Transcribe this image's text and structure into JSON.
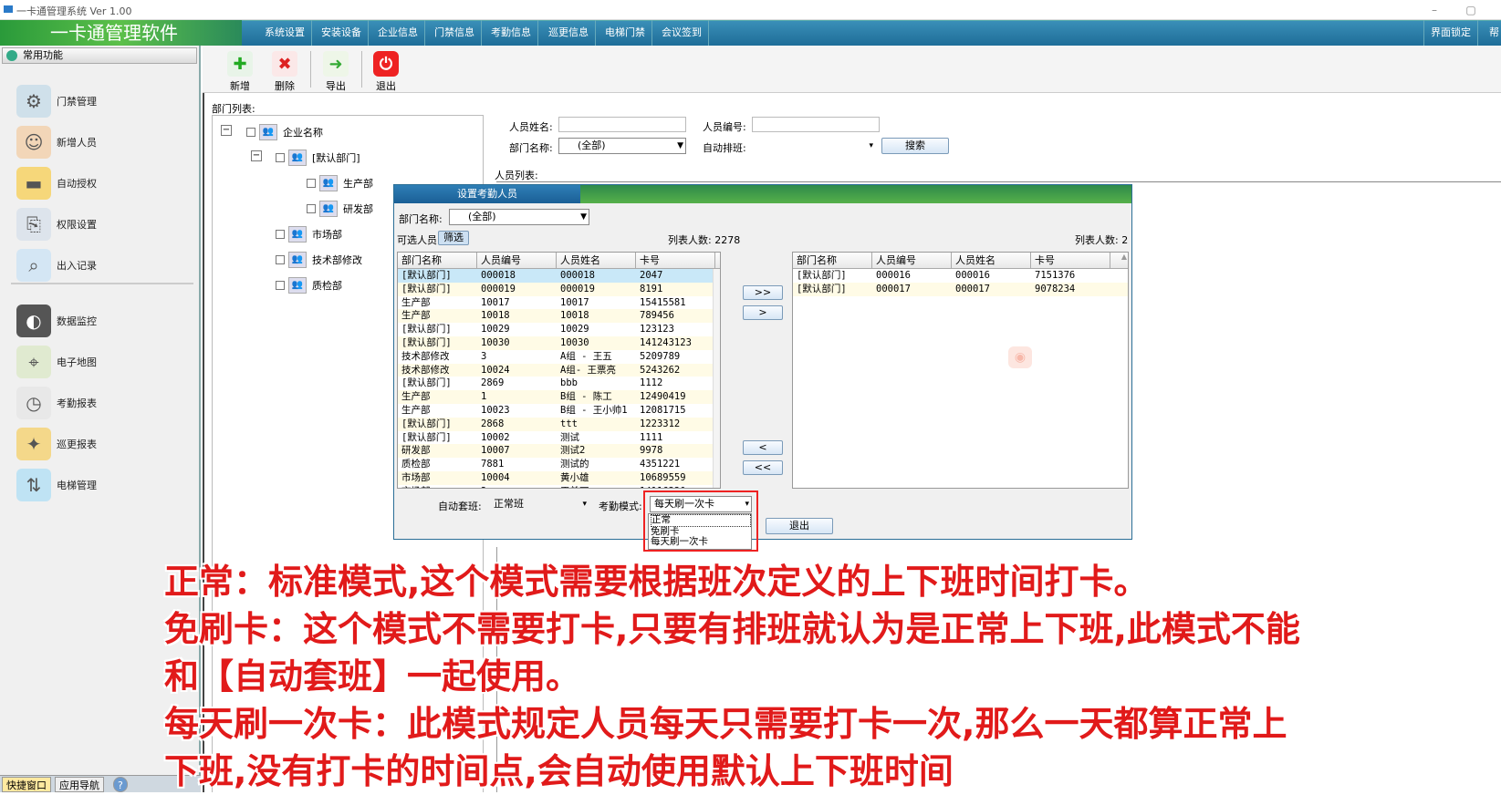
{
  "window": {
    "title": "一卡通管理系统  Ver 1.00"
  },
  "brand": "一卡通管理软件",
  "menu": [
    "系统设置",
    "安装设备",
    "企业信息",
    "门禁信息",
    "考勤信息",
    "巡更信息",
    "电梯门禁",
    "会议签到"
  ],
  "menu_right": "界面锁定",
  "menu_right2": "帮",
  "sidebar": {
    "header": "常用功能",
    "items": [
      {
        "label": "门禁管理",
        "icon": "door-access-icon"
      },
      {
        "label": "新增人员",
        "icon": "person-icon"
      },
      {
        "label": "自动授权",
        "icon": "card-icon"
      },
      {
        "label": "权限设置",
        "icon": "permission-icon"
      },
      {
        "label": "出入记录",
        "icon": "magnifier-icon"
      },
      {
        "label": "数据监控",
        "icon": "camera-icon"
      },
      {
        "label": "电子地图",
        "icon": "map-icon"
      },
      {
        "label": "考勤报表",
        "icon": "clock-icon"
      },
      {
        "label": "巡更报表",
        "icon": "patrol-icon"
      },
      {
        "label": "电梯管理",
        "icon": "elevator-icon"
      }
    ],
    "bottom_tabs": [
      "快捷窗口",
      "应用导航"
    ]
  },
  "toolbar": {
    "add": "新增",
    "delete": "删除",
    "export": "导出",
    "exit": "退出"
  },
  "dept_list_label": "部门列表:",
  "tree": {
    "root": "企业名称",
    "nodes": [
      "[默认部门]",
      "生产部",
      "研发部",
      "市场部",
      "技术部修改",
      "质检部"
    ]
  },
  "search": {
    "name_label": "人员姓名:",
    "id_label": "人员编号:",
    "dept_label": "部门名称:",
    "dept_value": "(全部)",
    "shift_label": "自动排班:",
    "search_btn": "搜索",
    "person_list_label": "人员列表:"
  },
  "dialog": {
    "title": "设置考勤人员",
    "dept_label": "部门名称:",
    "dept_value": "(全部)",
    "available_label": "可选人员",
    "filter_btn": "筛选",
    "left_count": "列表人数: 2278",
    "right_count": "列表人数: 2",
    "columns": [
      "部门名称",
      "人员编号",
      "人员姓名",
      "卡号"
    ],
    "left_rows": [
      [
        "[默认部门]",
        "000018",
        "000018",
        "2047"
      ],
      [
        "[默认部门]",
        "000019",
        "000019",
        "8191"
      ],
      [
        "生产部",
        "10017",
        "10017",
        "15415581"
      ],
      [
        "生产部",
        "10018",
        "10018",
        "789456"
      ],
      [
        "[默认部门]",
        "10029",
        "10029",
        "123123"
      ],
      [
        "[默认部门]",
        "10030",
        "10030",
        "141243123"
      ],
      [
        "技术部修改",
        "3",
        "A组 - 王五",
        "5209789"
      ],
      [
        "技术部修改",
        "10024",
        "A组- 王票亮",
        "5243262"
      ],
      [
        "[默认部门]",
        "2869",
        "bbb",
        "1112"
      ],
      [
        "生产部",
        "1",
        "B组 - 陈工",
        "12490419"
      ],
      [
        "生产部",
        "10023",
        "B组 - 王小帅1",
        "12081715"
      ],
      [
        "[默认部门]",
        "2868",
        "ttt",
        "1223312"
      ],
      [
        "[默认部门]",
        "10002",
        "测试",
        "1111"
      ],
      [
        "研发部",
        "10007",
        "测试2",
        "9978"
      ],
      [
        "质检部",
        "7881",
        "测试的",
        "4351221"
      ],
      [
        "市场部",
        "10004",
        "黄小雄",
        "10689559"
      ],
      [
        "市场部",
        "2",
        "王美丽",
        "14116330"
      ]
    ],
    "right_rows": [
      [
        "[默认部门]",
        "000016",
        "000016",
        "7151376"
      ],
      [
        "[默认部门]",
        "000017",
        "000017",
        "9078234"
      ]
    ],
    "btn_all_right": ">>",
    "btn_right": ">",
    "btn_left": "<",
    "btn_all_left": "<<",
    "auto_shift_label": "自动套班:",
    "auto_shift_value": "正常班",
    "mode_label": "考勤模式:",
    "mode_value": "每天刷一次卡",
    "mode_options": [
      "正常",
      "免刷卡",
      "每天刷一次卡"
    ],
    "exit_btn": "退出"
  },
  "caption": [
    "正常：标准模式,这个模式需要根据班次定义的上下班时间打卡。",
    "免刷卡：这个模式不需要打卡,只要有排班就认为是正常上下班,此模式不能",
    "和【自动套班】一起使用。",
    "每天刷一次卡：此模式规定人员每天只需要打卡一次,那么一天都算正常上",
    "下班,没有打卡的时间点,会自动使用默认上下班时间"
  ]
}
